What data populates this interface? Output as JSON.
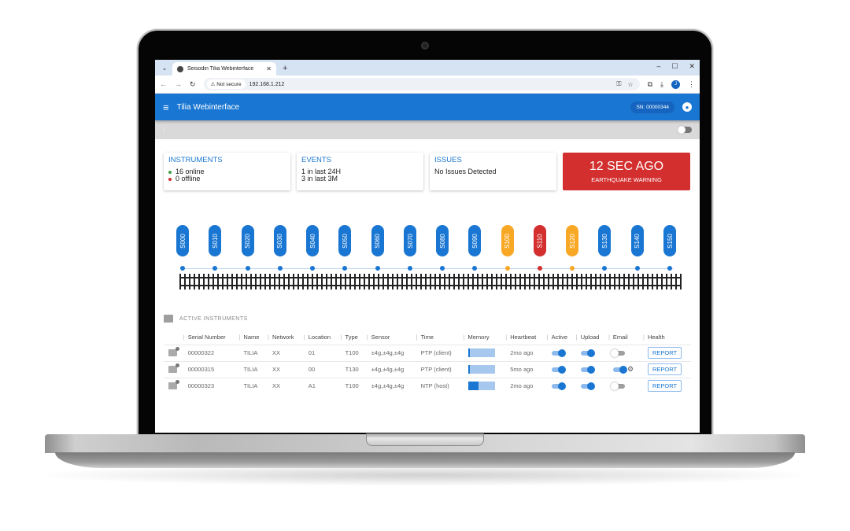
{
  "browser": {
    "tab_title": "Seisodin Tilia Webinterface",
    "security_label": "Not secure",
    "url": "192.168.1.212",
    "profile_initial": "J"
  },
  "app": {
    "title": "Tilia Webinterface",
    "serial_badge": "SN: 00000344",
    "breadcrumb": "/"
  },
  "cards": {
    "instruments": {
      "title": "INSTRUMENTS",
      "online": "16 online",
      "offline": "0 offline"
    },
    "events": {
      "title": "EVENTS",
      "line1": "1 in last 24H",
      "line2": "3 in last 3M"
    },
    "issues": {
      "title": "ISSUES",
      "text": "No Issues Detected"
    },
    "alert": {
      "time": "12 SEC AGO",
      "label": "EARTHQUAKE WARNING"
    }
  },
  "colors": {
    "primary": "#1976d2",
    "ok": "#43a047",
    "warn": "#f9a825",
    "alarm": "#d32f2f"
  },
  "stations": [
    {
      "id": "S000",
      "status": "ok"
    },
    {
      "id": "S010",
      "status": "ok"
    },
    {
      "id": "S020",
      "status": "ok"
    },
    {
      "id": "S030",
      "status": "ok"
    },
    {
      "id": "S040",
      "status": "ok"
    },
    {
      "id": "S050",
      "status": "ok"
    },
    {
      "id": "S060",
      "status": "ok"
    },
    {
      "id": "S070",
      "status": "ok"
    },
    {
      "id": "S080",
      "status": "ok"
    },
    {
      "id": "S090",
      "status": "ok"
    },
    {
      "id": "S100",
      "status": "warn"
    },
    {
      "id": "S110",
      "status": "alarm"
    },
    {
      "id": "S120",
      "status": "warn"
    },
    {
      "id": "S130",
      "status": "ok"
    },
    {
      "id": "S140",
      "status": "ok"
    },
    {
      "id": "S150",
      "status": "ok"
    }
  ],
  "table": {
    "title": "ACTIVE INSTRUMENTS",
    "columns": [
      "Serial Number",
      "Name",
      "Network",
      "Location",
      "Type",
      "Sensor",
      "Time",
      "Memory",
      "Heartbeat",
      "Active",
      "Upload",
      "Email",
      "Health"
    ],
    "rows": [
      {
        "serial": "00000322",
        "name": "TILIA",
        "network": "XX",
        "location": "01",
        "type": "T100",
        "sensor": "±4g,±4g,±4g",
        "time": "PTP (client)",
        "memory_pct": 8,
        "heartbeat": "2mo ago",
        "active": true,
        "upload": true,
        "email": false,
        "email_settings": false,
        "health": "REPORT"
      },
      {
        "serial": "00000315",
        "name": "TILIA",
        "network": "XX",
        "location": "00",
        "type": "T130",
        "sensor": "±4g,±4g,±4g",
        "time": "PTP (client)",
        "memory_pct": 8,
        "heartbeat": "5mo ago",
        "active": true,
        "upload": true,
        "email": true,
        "email_settings": true,
        "health": "REPORT"
      },
      {
        "serial": "00000323",
        "name": "TILIA",
        "network": "XX",
        "location": "A1",
        "type": "T100",
        "sensor": "±4g,±4g,±4g",
        "time": "NTP (host)",
        "memory_pct": 40,
        "heartbeat": "2mo ago",
        "active": true,
        "upload": true,
        "email": false,
        "email_settings": false,
        "health": "REPORT"
      }
    ]
  }
}
